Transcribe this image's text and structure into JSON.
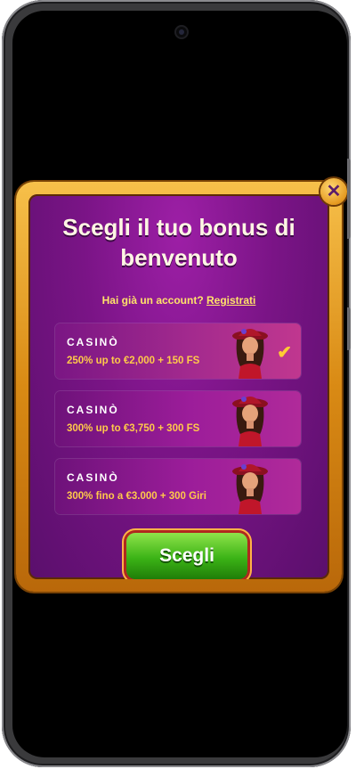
{
  "modal": {
    "title_line1": "Scegli il tuo bonus di",
    "title_line2": "benvenuto",
    "login_prompt": "Hai già un account?",
    "login_link": "Registrati",
    "close_icon": "close-icon",
    "offers": [
      {
        "category": "CASINÒ",
        "description": "250% up to €2,000 + 150 FS",
        "selected": true
      },
      {
        "category": "CASINÒ",
        "description": "300% up to €3,750 + 300 FS",
        "selected": false
      },
      {
        "category": "CASINÒ",
        "description": "300% fino a €3.000 + 300 Giri",
        "selected": false
      }
    ],
    "choose_button": "Scegli"
  },
  "colors": {
    "panel_purple": "#7a1486",
    "frame_gold": "#e59a20",
    "accent_yellow": "#ffc94a",
    "button_green": "#3bb316"
  }
}
